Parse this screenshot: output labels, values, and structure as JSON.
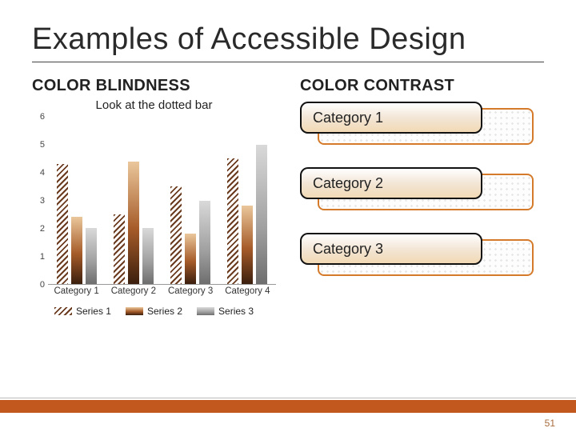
{
  "title": "Examples of  Accessible Design",
  "left": {
    "heading": "COLOR BLINDNESS",
    "chart_title": "Look at the dotted bar"
  },
  "right": {
    "heading": "COLOR CONTRAST",
    "cat1": "Category 1",
    "cat2": "Category 2",
    "cat3": "Category 3"
  },
  "legend": {
    "s1": "Series 1",
    "s2": "Series 2",
    "s3": "Series 3"
  },
  "page_number": "51",
  "chart_data": {
    "type": "bar",
    "title": "Look at the dotted bar",
    "xlabel": "",
    "ylabel": "",
    "ylim": [
      0,
      6
    ],
    "yticks": [
      0,
      1,
      2,
      3,
      4,
      5,
      6
    ],
    "categories": [
      "Category 1",
      "Category 2",
      "Category 3",
      "Category 4"
    ],
    "series": [
      {
        "name": "Series 1",
        "pattern": "hatched",
        "values": [
          4.3,
          2.5,
          3.5,
          4.5
        ]
      },
      {
        "name": "Series 2",
        "pattern": "solid-gradient",
        "values": [
          2.4,
          4.4,
          1.8,
          2.8
        ]
      },
      {
        "name": "Series 3",
        "pattern": "solid-grey",
        "values": [
          2.0,
          2.0,
          3.0,
          5.0
        ]
      }
    ],
    "legend_position": "bottom",
    "grid": false
  }
}
